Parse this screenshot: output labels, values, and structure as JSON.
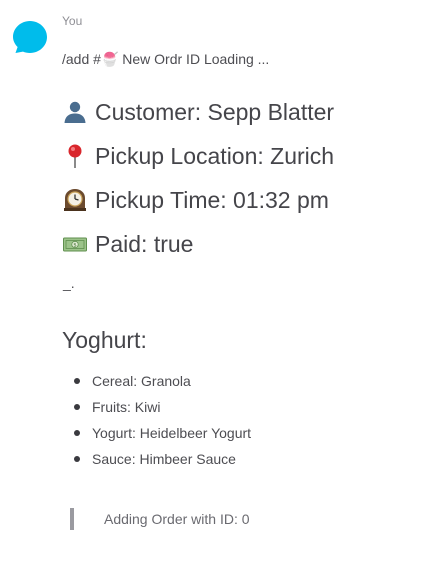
{
  "message": {
    "sender": "You",
    "command_prefix": "/add #",
    "command_emoji": "🍧",
    "command_suffix": " New Ordr ID Loading ...",
    "details": [
      {
        "icon": "person-silhouette-icon",
        "text": "Customer: Sepp Blatter"
      },
      {
        "icon": "round-pushpin-icon",
        "text": "Pickup Location: Zurich"
      },
      {
        "icon": "mantelpiece-clock-icon",
        "text": "Pickup Time: 01:32 pm"
      },
      {
        "icon": "dollar-banknote-icon",
        "text": "Paid: true"
      }
    ],
    "cursor": "_.",
    "section_title": "Yoghurt:",
    "items": [
      "Cereal: Granola",
      "Fruits: Kiwi",
      "Yogurt: Heidelbeer Yogurt",
      "Sauce: Himbeer Sauce"
    ],
    "quote": "Adding Order with ID: 0"
  },
  "colors": {
    "avatar": "#00bceb",
    "text": "#45454a",
    "muted": "#8f8f95",
    "quote_bar": "#9a9aa0"
  }
}
